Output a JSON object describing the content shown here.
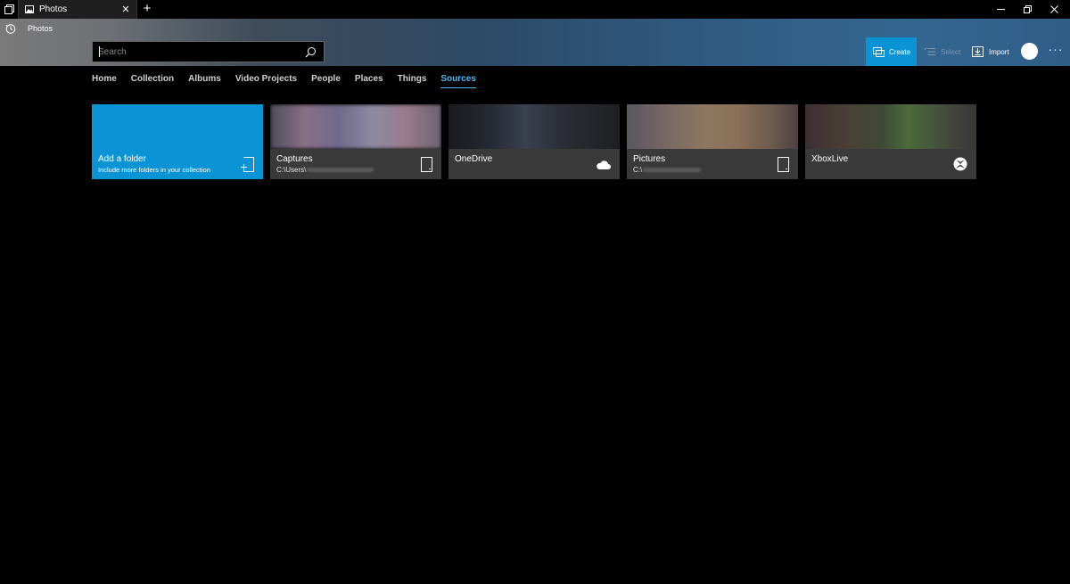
{
  "window": {
    "tab_title": "Photos",
    "new_tab_symbol": "+",
    "close_tab_symbol": "✕"
  },
  "header": {
    "app_title": "Photos",
    "search": {
      "placeholder": "Search",
      "value": ""
    },
    "actions": {
      "create_label": "Create",
      "select_label": "Select",
      "import_label": "Import",
      "more_label": "···"
    }
  },
  "nav": {
    "items": [
      {
        "label": "Home"
      },
      {
        "label": "Collection"
      },
      {
        "label": "Albums"
      },
      {
        "label": "Video Projects"
      },
      {
        "label": "People"
      },
      {
        "label": "Places"
      },
      {
        "label": "Things"
      },
      {
        "label": "Sources"
      }
    ],
    "active": "Sources"
  },
  "sources": {
    "add_folder": {
      "title": "Add a folder",
      "subtitle": "Include more folders in your collection",
      "icon": "add-folder-icon"
    },
    "tiles": [
      {
        "name": "Captures",
        "path": "C:\\Users\\",
        "icon": "device-icon"
      },
      {
        "name": "OneDrive",
        "path": "",
        "icon": "cloud-icon"
      },
      {
        "name": "Pictures",
        "path": "C:\\",
        "icon": "device-icon"
      },
      {
        "name": "XboxLive",
        "path": "",
        "icon": "xbox-icon"
      }
    ]
  },
  "colors": {
    "accent": "#0a94d6",
    "active_nav": "#4fb8f0",
    "background": "#000000",
    "tile_caption": "#3a3a3a"
  }
}
